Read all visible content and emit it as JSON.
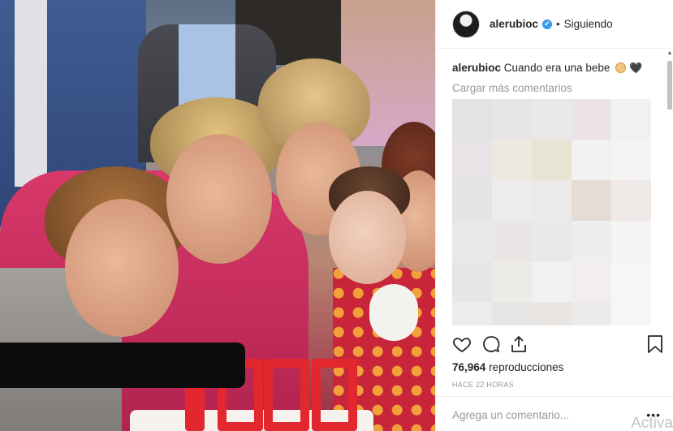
{
  "post": {
    "username": "alerubioc",
    "verified_mark": "✔",
    "separator": "•",
    "follow_status": "Siguiendo"
  },
  "caption": {
    "username": "alerubioc",
    "text": "Cuando era una bebe",
    "emoji_heart": "🖤"
  },
  "comments": {
    "load_more": "Cargar más comentarios",
    "blurred_colors": [
      "#e3e3e3",
      "#e6e6e6",
      "#e9e9e9",
      "#ebe3e6",
      "#f1f1f1",
      "#e8e3e5",
      "#ede9e0",
      "#e8e4d4",
      "#f1f1f1",
      "#f4f4f4",
      "#e4e4e4",
      "#ececec",
      "#eaeaea",
      "#e7dcd3",
      "#eee9e6",
      "#e8e8e8",
      "#ebe6e6",
      "#e9e9e9",
      "#eeeeee",
      "#f4f4f4",
      "#e6e6e6",
      "#ecebe6",
      "#f1f1f1",
      "#f3eded",
      "#f6f6f6",
      "#ececec",
      "#e6e6e6",
      "#e9e5e2",
      "#ebebeb",
      "#f6f6f6"
    ]
  },
  "actions": {
    "like_icon": "heart-outline",
    "comment_icon": "speech-bubble",
    "share_icon": "share-arrow",
    "save_icon": "bookmark"
  },
  "stats": {
    "views_count": "76,964",
    "views_label": "reproducciones",
    "timestamp": "HACE 22 HORAS"
  },
  "composer": {
    "placeholder": "Agrega un comentario...",
    "more_label": "•••"
  },
  "os": {
    "watermark": "Activa"
  },
  "colors": {
    "verified_blue": "#3897f0",
    "muted_text": "#999999",
    "border": "#efefef"
  }
}
